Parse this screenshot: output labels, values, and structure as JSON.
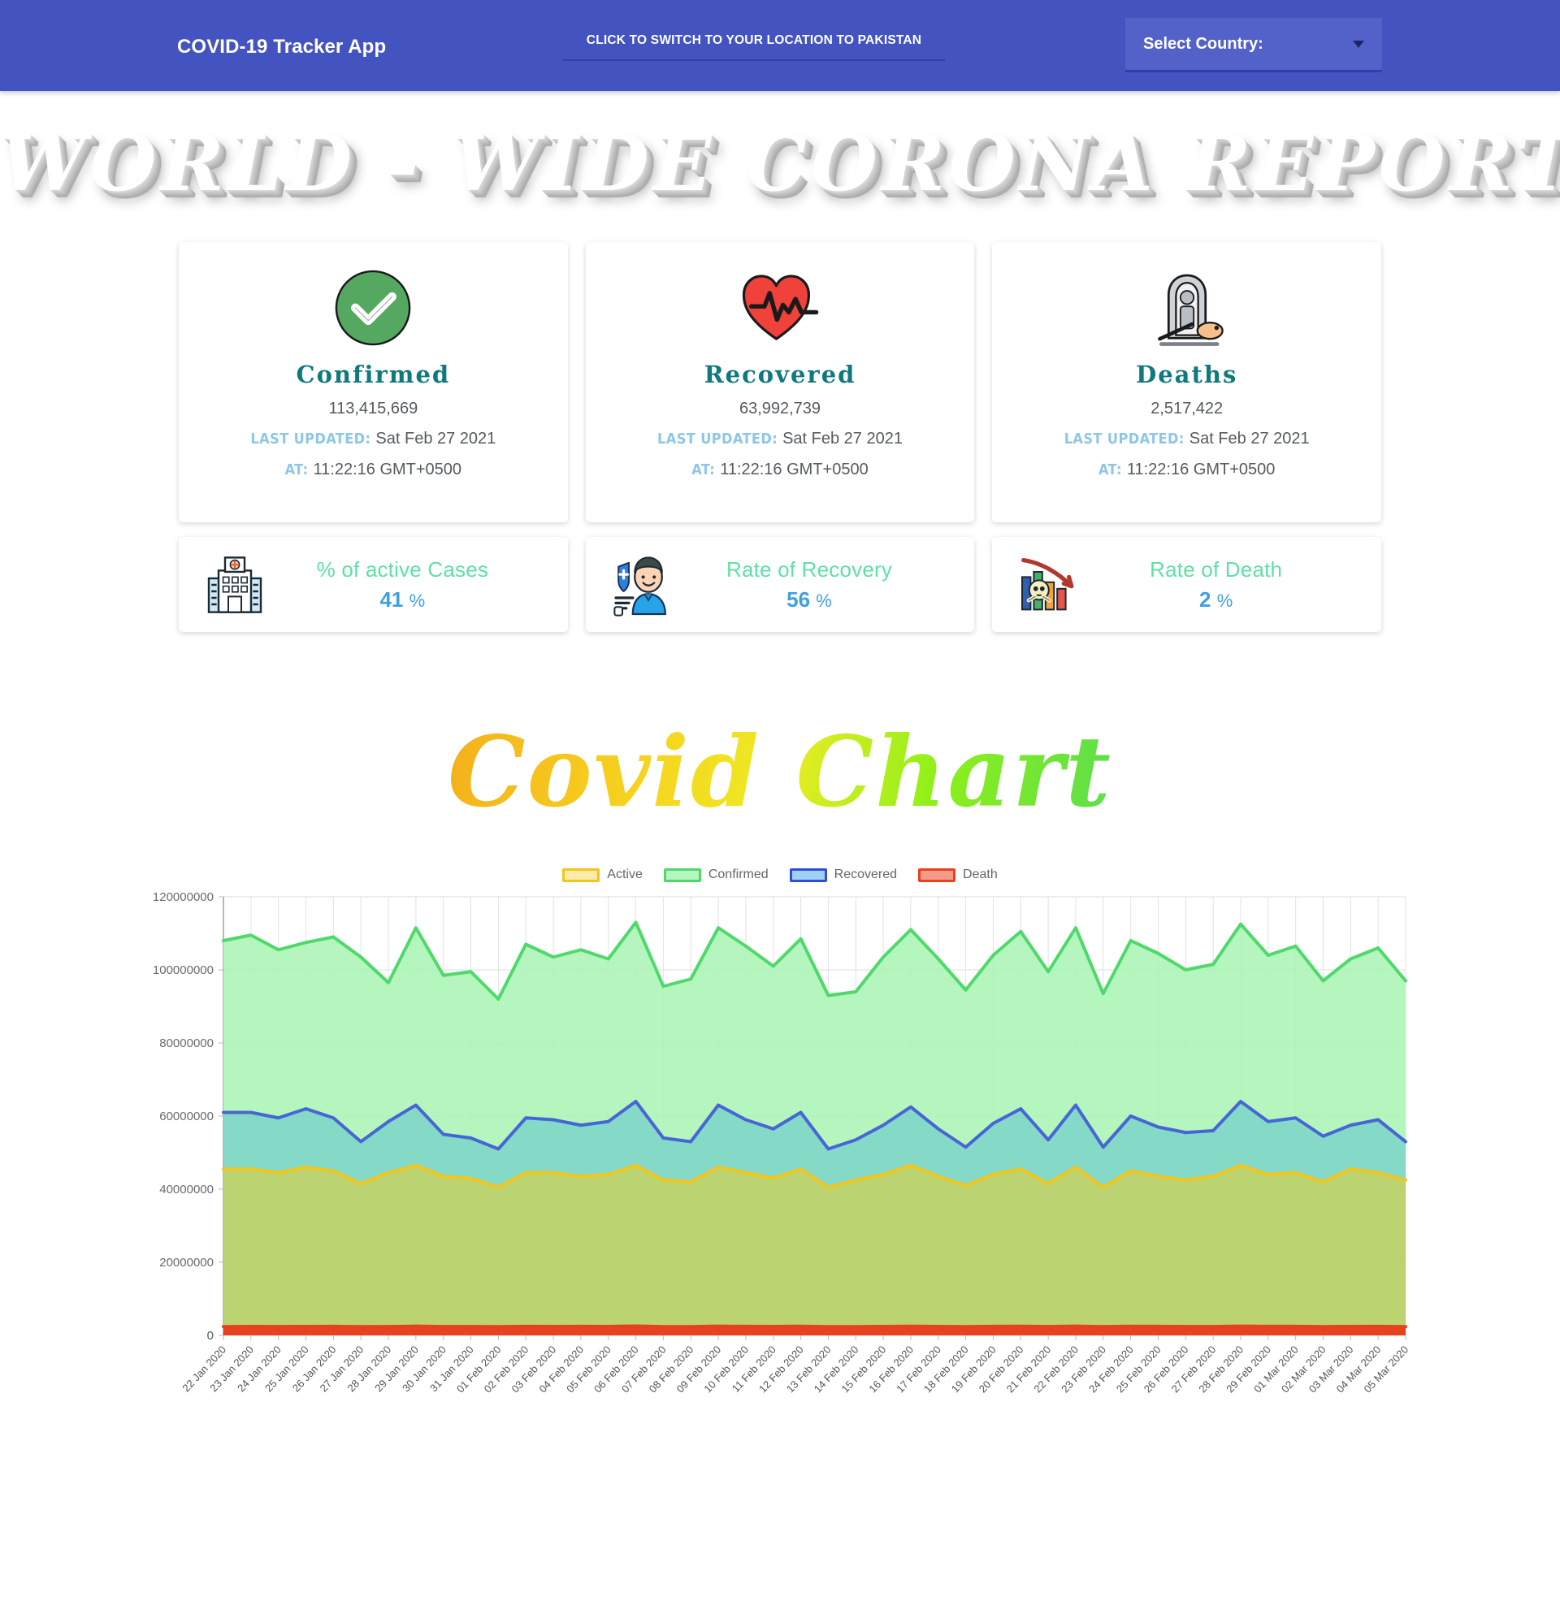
{
  "navbar": {
    "brand": "COVID-19 Tracker App",
    "switch_button": "CLICK TO SWITCH TO YOUR LOCATION TO PAKISTAN",
    "select_country_label": "Select Country:",
    "background_color": "#4353c0"
  },
  "page_title": "WORLD - WIDE  CORONA REPORT",
  "stat_cards": [
    {
      "icon": "check-circle-icon",
      "title": "Confirmed",
      "value": "113,415,669",
      "updated_label": "LAST UPDATED:",
      "updated_value": "Sat Feb 27 2021",
      "time_label": "AT:",
      "time_value": "11:22:16 GMT+0500"
    },
    {
      "icon": "heart-pulse-icon",
      "title": "Recovered",
      "value": "63,992,739",
      "updated_label": "LAST UPDATED:",
      "updated_value": "Sat Feb 27 2021",
      "time_label": "AT:",
      "time_value": "11:22:16 GMT+0500"
    },
    {
      "icon": "tombstone-icon",
      "title": "Deaths",
      "value": "2,517,422",
      "updated_label": "LAST UPDATED:",
      "updated_value": "Sat Feb 27 2021",
      "time_label": "AT:",
      "time_value": "11:22:16 GMT+0500"
    }
  ],
  "rate_cards": [
    {
      "icon": "hospital-icon",
      "label": "% of active Cases",
      "value": "41",
      "unit": "%"
    },
    {
      "icon": "recovered-person-icon",
      "label": "Rate of Recovery",
      "value": "56",
      "unit": "%"
    },
    {
      "icon": "death-chart-icon",
      "label": "Rate of Death",
      "value": "2",
      "unit": "%"
    }
  ],
  "chart_heading": "Covid Chart",
  "chart_data": {
    "type": "area",
    "title": "Covid Chart",
    "xlabel": "",
    "ylabel": "",
    "ylim": [
      0,
      120000000
    ],
    "yticks": [
      0,
      20000000,
      40000000,
      60000000,
      80000000,
      100000000,
      120000000
    ],
    "ytick_labels": [
      "0",
      "20000000",
      "40000000",
      "60000000",
      "80000000",
      "100000000",
      "120000000"
    ],
    "grid": true,
    "legend_position": "top-center",
    "categories": [
      "22 Jan 2020",
      "23 Jan 2020",
      "24 Jan 2020",
      "25 Jan 2020",
      "26 Jan 2020",
      "27 Jan 2020",
      "28 Jan 2020",
      "29 Jan 2020",
      "30 Jan 2020",
      "31 Jan 2020",
      "01 Feb 2020",
      "02 Feb 2020",
      "03 Feb 2020",
      "04 Feb 2020",
      "05 Feb 2020",
      "06 Feb 2020",
      "07 Feb 2020",
      "08 Feb 2020",
      "09 Feb 2020",
      "10 Feb 2020",
      "11 Feb 2020",
      "12 Feb 2020",
      "13 Feb 2020",
      "14 Feb 2020",
      "15 Feb 2020",
      "16 Feb 2020",
      "17 Feb 2020",
      "18 Feb 2020",
      "19 Feb 2020",
      "20 Feb 2020",
      "21 Feb 2020",
      "22 Feb 2020",
      "23 Feb 2020",
      "24 Feb 2020",
      "25 Feb 2020",
      "26 Feb 2020",
      "27 Feb 2020",
      "28 Feb 2020",
      "29 Feb 2020",
      "01 Mar 2020",
      "02 Mar 2020",
      "03 Mar 2020",
      "04 Mar 2020",
      "05 Mar 2020"
    ],
    "series": [
      {
        "name": "Confirmed",
        "color": "#4fd96b",
        "fill": "#a8f5b4",
        "values": [
          108000000,
          109500000,
          105500000,
          107500000,
          109000000,
          103500000,
          96500000,
          111500000,
          98500000,
          99500000,
          92000000,
          107000000,
          103500000,
          105500000,
          103000000,
          113000000,
          95500000,
          97500000,
          111500000,
          106500000,
          101000000,
          108500000,
          93000000,
          94000000,
          103500000,
          111000000,
          103000000,
          94500000,
          104000000,
          110500000,
          99500000,
          111500000,
          93500000,
          108000000,
          104500000,
          100000000,
          101500000,
          112500000,
          104000000,
          106500000,
          97000000,
          103000000,
          106000000,
          97000000
        ]
      },
      {
        "name": "Recovered",
        "color": "#4766d6",
        "fill": "#7dd4c8",
        "values": [
          61000000,
          61000000,
          59500000,
          62000000,
          59500000,
          53000000,
          58500000,
          63000000,
          55000000,
          54000000,
          51000000,
          59500000,
          59000000,
          57500000,
          58500000,
          64000000,
          54000000,
          53000000,
          63000000,
          59000000,
          56500000,
          61000000,
          51000000,
          53500000,
          57500000,
          62500000,
          56500000,
          51500000,
          58000000,
          62000000,
          53500000,
          63000000,
          51500000,
          60000000,
          57000000,
          55500000,
          56000000,
          64000000,
          58500000,
          59500000,
          54500000,
          57500000,
          59000000,
          53000000
        ]
      },
      {
        "name": "Active",
        "color": "#f2c61c",
        "fill": "#c4d261",
        "values": [
          45500000,
          45500000,
          44500000,
          46000000,
          45000000,
          41500000,
          44500000,
          46500000,
          43500000,
          43000000,
          40500000,
          44500000,
          44500000,
          43500000,
          44000000,
          46500000,
          42500000,
          42000000,
          46000000,
          44500000,
          43000000,
          45500000,
          40500000,
          42500000,
          44000000,
          46500000,
          43500000,
          41000000,
          44000000,
          45500000,
          41500000,
          46000000,
          40500000,
          45000000,
          43500000,
          42500000,
          43500000,
          46500000,
          44000000,
          44500000,
          42000000,
          45500000,
          44500000,
          42500000
        ]
      },
      {
        "name": "Death",
        "color": "#e8411f",
        "fill": "#e8411f",
        "values": [
          2400000,
          2450000,
          2420000,
          2450000,
          2480000,
          2400000,
          2420000,
          2520000,
          2430000,
          2430000,
          2380000,
          2480000,
          2450000,
          2460000,
          2450000,
          2550000,
          2400000,
          2400000,
          2520000,
          2470000,
          2440000,
          2500000,
          2380000,
          2390000,
          2450000,
          2510000,
          2450000,
          2390000,
          2460000,
          2500000,
          2410000,
          2520000,
          2380000,
          2490000,
          2460000,
          2420000,
          2430000,
          2530000,
          2460000,
          2480000,
          2400000,
          2450000,
          2470000,
          2400000
        ]
      }
    ],
    "legend": [
      {
        "label": "Active",
        "color": "#f2c61c",
        "fill": "#fbeaa8"
      },
      {
        "label": "Confirmed",
        "color": "#4fd96b",
        "fill": "#b5f5c0"
      },
      {
        "label": "Recovered",
        "color": "#2f4fd0",
        "fill": "#9fd0f5"
      },
      {
        "label": "Death",
        "color": "#e8411f",
        "fill": "#f59b8c"
      }
    ]
  }
}
